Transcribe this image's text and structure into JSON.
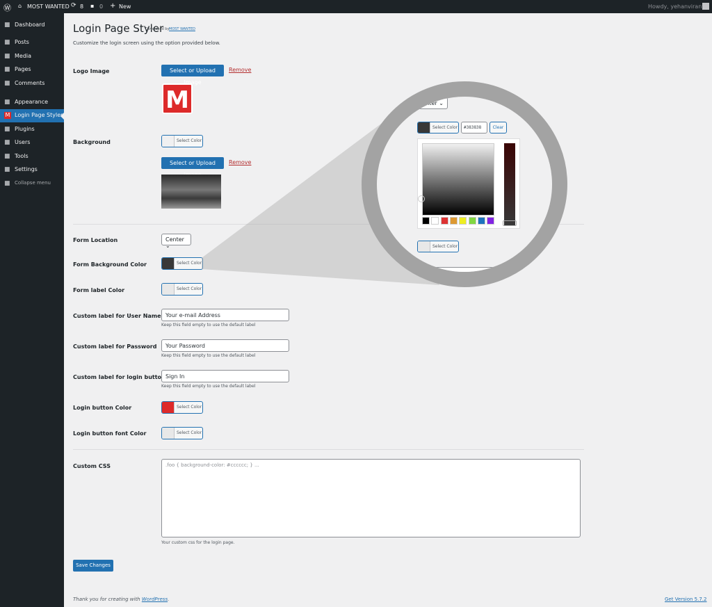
{
  "adminbar": {
    "site": "MOST WANTED",
    "updates": "8",
    "comments": "0",
    "new": "New",
    "howdy": "Howdy, yehanviranta"
  },
  "sidebar": {
    "items": [
      {
        "label": "Dashboard",
        "icon": "dashboard-icon"
      },
      {
        "label": "Posts",
        "icon": "pin-icon"
      },
      {
        "label": "Media",
        "icon": "media-icon"
      },
      {
        "label": "Pages",
        "icon": "pages-icon"
      },
      {
        "label": "Comments",
        "icon": "comment-icon"
      },
      {
        "label": "Appearance",
        "icon": "brush-icon"
      },
      {
        "label": "Login Page Styler",
        "icon": "m-logo-icon",
        "active": true
      },
      {
        "label": "Plugins",
        "icon": "plugin-icon"
      },
      {
        "label": "Users",
        "icon": "users-icon"
      },
      {
        "label": "Tools",
        "icon": "wrench-icon"
      },
      {
        "label": "Settings",
        "icon": "settings-icon"
      },
      {
        "label": "Collapse menu",
        "icon": "collapse-icon"
      }
    ]
  },
  "page": {
    "title": "Login Page Styler",
    "developed_by": "Developed by",
    "developer": "MOST WANTED",
    "description": "Customize the login screen using the option provided below."
  },
  "fields": {
    "logo_image": "Logo Image",
    "upload": "Select or Upload Image",
    "remove": "Remove",
    "background": "Background",
    "select_color": "Select Color",
    "form_location": "Form Location",
    "form_location_value": "Center",
    "form_bg_color": "Form Background Color",
    "form_label_color": "Form label Color",
    "username_label": "Custom label for User Name",
    "username_value": "Your e-mail Address",
    "password_label": "Custom label for Password",
    "password_value": "Your Password",
    "login_btn_label": "Custom label for login button",
    "login_btn_value": "Sign In",
    "hint": "Keep this field empty to use the default label",
    "login_btn_color": "Login button Color",
    "login_btn_font_color": "Login button font Color",
    "custom_css": "Custom CSS",
    "custom_css_placeholder": ".foo { background-color: #cccccc; } ...",
    "custom_css_hint": "Your custom css for the login page.",
    "save": "Save Changes"
  },
  "colors": {
    "form_bg": "#383838",
    "login_btn": "#dd2a2a",
    "accent": "#2271b1"
  },
  "magnifier": {
    "select_partial": "nter",
    "hex": "#383838",
    "clear": "Clear",
    "palette": [
      "#000000",
      "#ffffff",
      "#dd3333",
      "#dd9933",
      "#eeee22",
      "#81d742",
      "#1e73be",
      "#8224e3"
    ]
  },
  "footer": {
    "thanks": "Thank you for creating with",
    "wp": "WordPress",
    "version": "Get Version 5.7.2"
  }
}
